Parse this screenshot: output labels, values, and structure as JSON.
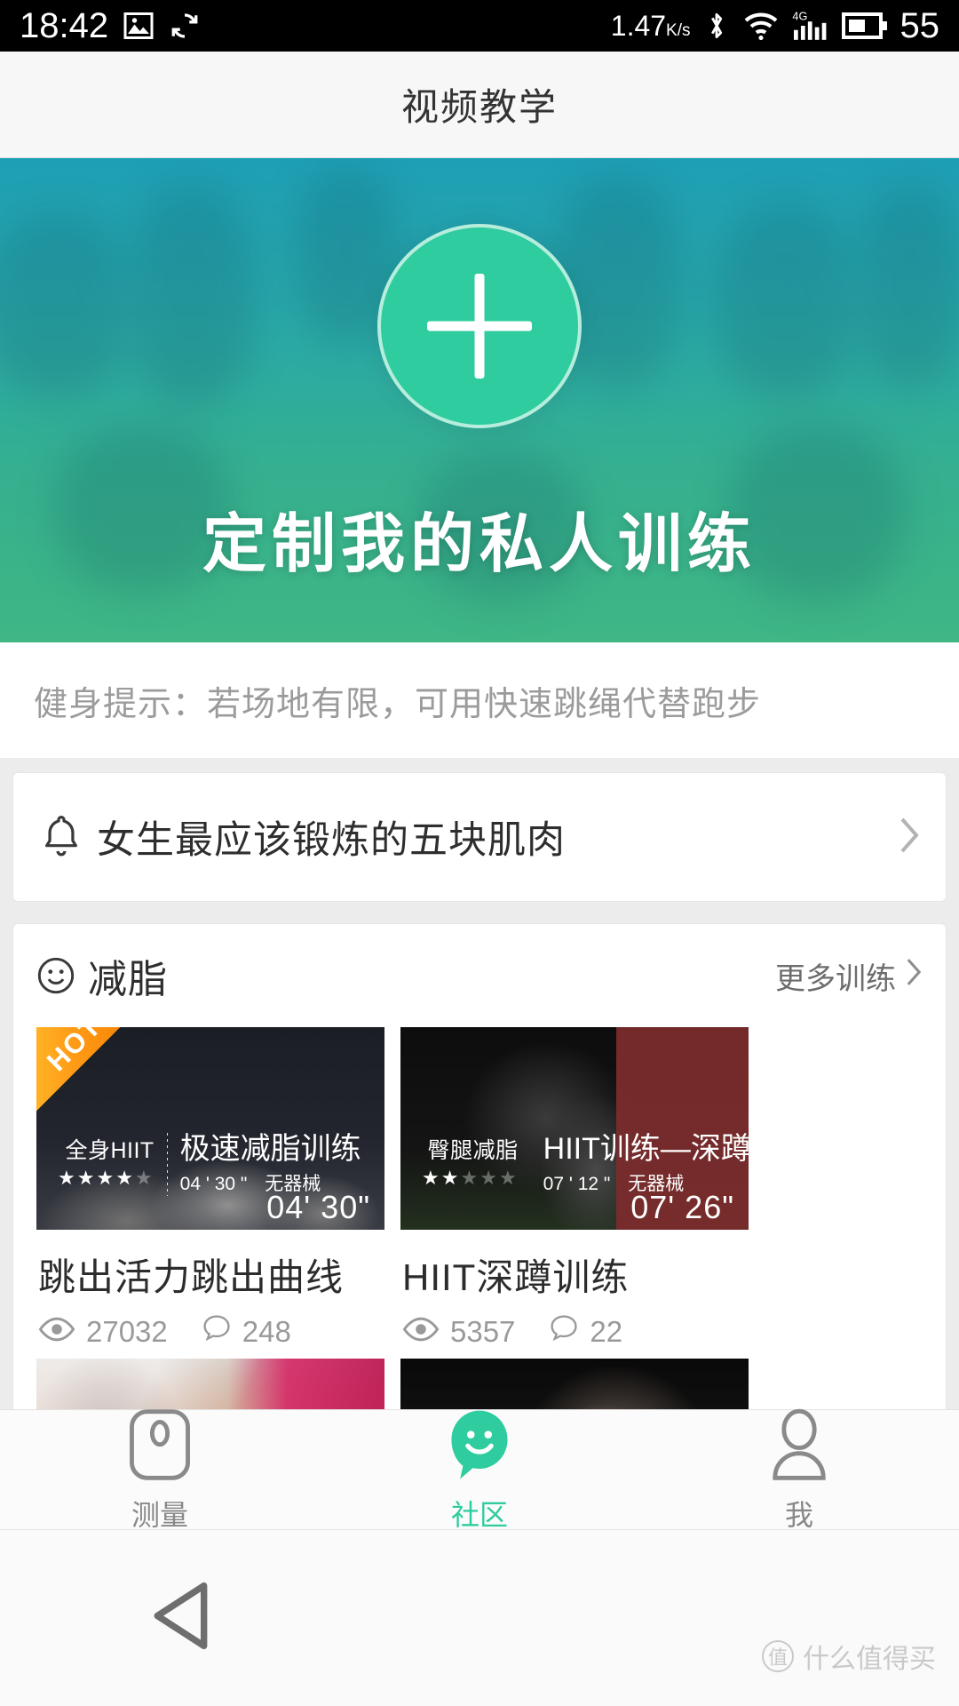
{
  "statusbar": {
    "time": "18:42",
    "icons_left": [
      "image-icon",
      "sync-icon"
    ],
    "net_speed_value": "1.47",
    "net_speed_unit": "K/s",
    "icons_right": [
      "bluetooth-icon",
      "wifi-icon",
      "signal-4g-icon",
      "battery-icon"
    ],
    "battery_level": "55",
    "network_type": "4G"
  },
  "header": {
    "title": "视频教学"
  },
  "hero": {
    "plus_icon": "plus-icon",
    "slogan": "定制我的私人训练",
    "accent": "#2ecc9e",
    "gradient_from": "#1e9fb5",
    "gradient_to": "#3fb684"
  },
  "tip": {
    "text": "健身提示：若场地有限，可用快速跳绳代替跑步"
  },
  "notice": {
    "icon": "bell-icon",
    "text": "女生最应该锻炼的五块肌肉",
    "chevron": "chevron-right-icon"
  },
  "section": {
    "icon": "smiley-icon",
    "title": "减脂",
    "more_label": "更多训练",
    "more_chevron": "chevron-right-icon",
    "videos": [
      {
        "badge": "HOT",
        "category": "全身HIIT",
        "stars_filled": 4,
        "stars_total": 5,
        "name": "极速减脂训练",
        "duration_small": "04 ' 30 \"",
        "equipment": "无器械",
        "duration_big": "04' 30\"",
        "title": "跳出活力跳出曲线",
        "views": "27032",
        "comments": "248"
      },
      {
        "badge": "",
        "category": "臀腿减脂",
        "stars_filled": 2,
        "stars_total": 5,
        "name": "HIIT训练—深蹲",
        "duration_small": "07 ' 12 \"",
        "equipment": "无器械",
        "duration_big": "07' 26\"",
        "title": "HIIT深蹲训练",
        "views": "5357",
        "comments": "22"
      }
    ]
  },
  "tabbar": {
    "active_color": "#2ecc9e",
    "items": [
      {
        "icon": "scale-icon",
        "label": "测量",
        "active": false
      },
      {
        "icon": "community-smiley-icon",
        "label": "社区",
        "active": true
      },
      {
        "icon": "person-icon",
        "label": "我",
        "active": false
      }
    ]
  },
  "navbar": {
    "back_icon": "back-triangle-icon"
  },
  "watermark": {
    "mark": "值",
    "text": "什么值得买"
  }
}
